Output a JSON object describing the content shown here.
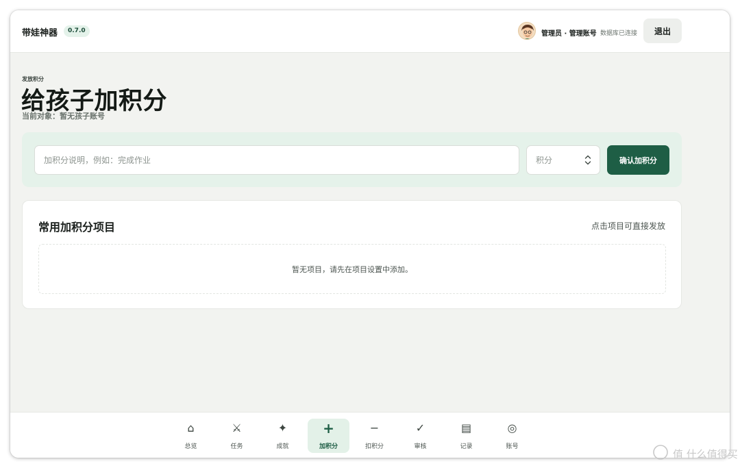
{
  "header": {
    "app_title": "带娃神器",
    "version": "0.7.0",
    "user_label": "管理员 · 管理账号",
    "db_status": "数据库已连接",
    "logout_label": "退出"
  },
  "page": {
    "eyebrow": "发放积分",
    "title": "给孩子加积分",
    "current_target": "当前对象：暂无孩子账号"
  },
  "form": {
    "description_placeholder": "加积分说明，例如：完成作业",
    "description_value": "",
    "points_placeholder": "积分",
    "points_value": "",
    "confirm_label": "确认加积分"
  },
  "common_items": {
    "title": "常用加积分项目",
    "hint": "点击项目可直接发放",
    "empty_text": "暂无项目，请先在项目设置中添加。"
  },
  "bottom_nav": {
    "active_index": 3,
    "items": [
      {
        "label": "总览",
        "icon": "home-icon",
        "glyph": "⌂"
      },
      {
        "label": "任务",
        "icon": "swords-icon",
        "glyph": "⚔"
      },
      {
        "label": "成就",
        "icon": "sparkle-icon",
        "glyph": "✦"
      },
      {
        "label": "加积分",
        "icon": "plus-icon",
        "glyph": "+"
      },
      {
        "label": "扣积分",
        "icon": "minus-icon",
        "glyph": "−"
      },
      {
        "label": "审核",
        "icon": "check-icon",
        "glyph": "✓"
      },
      {
        "label": "记录",
        "icon": "list-icon",
        "glyph": "▤"
      },
      {
        "label": "账号",
        "icon": "account-icon",
        "glyph": "◎"
      }
    ]
  },
  "watermark": {
    "text": "值 什么值得买"
  },
  "colors": {
    "accent": "#1e5e45",
    "accent_soft": "#e5f2ea",
    "background": "#f2f3f0"
  }
}
